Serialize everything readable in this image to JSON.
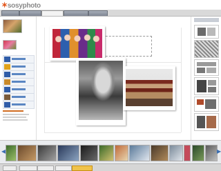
{
  "app": {
    "logo_text": "sosyphoto",
    "logo_mark": ""
  },
  "tabs": [
    {
      "label": ""
    },
    {
      "label": ""
    },
    {
      "label": ""
    },
    {
      "label": ""
    },
    {
      "label": ""
    }
  ],
  "active_tab_index": 2,
  "left_panel": {
    "sections": []
  },
  "right_panel": {
    "thumbnails": 6
  },
  "filmstrip": {
    "thumbnail_count": 14
  },
  "statusbar": {
    "buttons": []
  },
  "colors": {
    "accent": "#e2561c",
    "tab_active": "#f3f3f3",
    "tab_inactive": "#8d939e",
    "filmstrip_bg": "#e9ebee"
  }
}
